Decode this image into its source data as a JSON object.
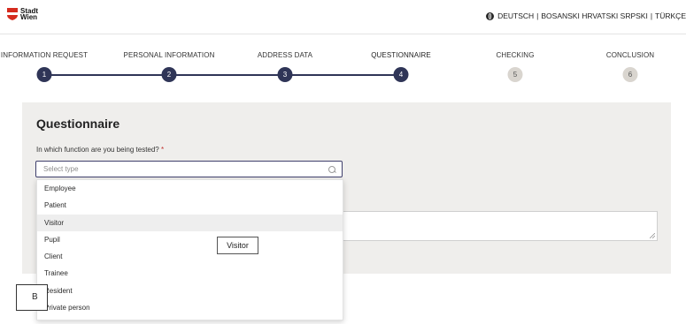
{
  "header": {
    "logo_line1": "Stadt",
    "logo_line2": "Wien",
    "languages": [
      "DEUTSCH",
      "BOSANSKI HRVATSKI SRPSKI",
      "TÜRKÇE"
    ],
    "active_color": "#2f3557",
    "brand_color": "#d52b1e"
  },
  "stepper": {
    "steps": [
      {
        "label": "INFORMATION REQUEST",
        "number": "1",
        "state": "done"
      },
      {
        "label": "PERSONAL INFORMATION",
        "number": "2",
        "state": "done"
      },
      {
        "label": "ADDRESS DATA",
        "number": "3",
        "state": "done"
      },
      {
        "label": "QUESTIONNAIRE",
        "number": "4",
        "state": "current"
      },
      {
        "label": "CHECKING",
        "number": "5",
        "state": "pending"
      },
      {
        "label": "CONCLUSION",
        "number": "6",
        "state": "pending"
      }
    ]
  },
  "form": {
    "title": "Questionnaire",
    "question": "In which function are you being tested?",
    "required_mark": "*",
    "select_placeholder": "Select type",
    "options": [
      "Employee",
      "Patient",
      "Visitor",
      "Pupil",
      "Client",
      "Trainee",
      "Resident",
      "Private person"
    ],
    "hovered_option": "Visitor",
    "tooltip": "Visitor"
  },
  "footer": {
    "back_label": "B"
  }
}
